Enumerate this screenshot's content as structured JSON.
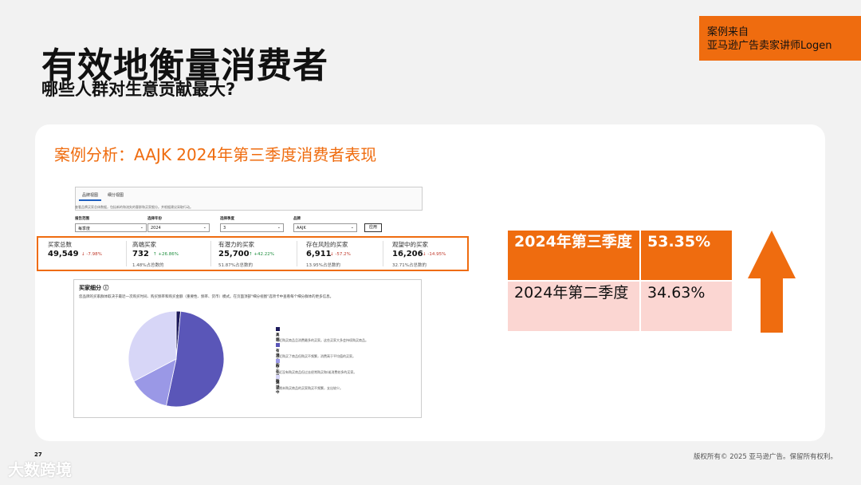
{
  "header": {
    "title": "有效地衡量消费者",
    "subtitle": "哪些人群对生意贡献最大?"
  },
  "source_badge": {
    "line1": "案例来自",
    "line2": "亚马逊广告卖家讲师Logen"
  },
  "card": {
    "title": "案例分析：AAJK 2024年第三季度消费者表现"
  },
  "screenshot": {
    "tabs": [
      {
        "label": "品牌视图",
        "active": true
      },
      {
        "label": "细分视图",
        "active": false
      }
    ],
    "description": "查看品牌买家总体数据，包括新的和流失的客群和买家细分。并根据建议采取行动。",
    "filters": [
      {
        "label": "报告范围",
        "value": "每季度"
      },
      {
        "label": "选择年份",
        "value": "2024"
      },
      {
        "label": "选择季度",
        "value": "3"
      },
      {
        "label": "品牌",
        "value": "AAJK"
      }
    ],
    "apply_label": "应用",
    "metrics": [
      {
        "label": "买家总数",
        "value": "49,549",
        "change": "↓ -7.98%",
        "trend": "down",
        "share": ""
      },
      {
        "label": "高端买家",
        "value": "732",
        "change": "↑ +26.86%",
        "trend": "up",
        "share": "1.48%占总数的"
      },
      {
        "label": "有潜力的买家",
        "value": "25,700",
        "change": "↑ +42.22%",
        "trend": "up",
        "share": "51.87%占总数的"
      },
      {
        "label": "存在风险的买家",
        "value": "6,911",
        "change": "↓ -57.2%",
        "trend": "down",
        "share": "13.95%占总数的"
      },
      {
        "label": "观望中的买家",
        "value": "16,206",
        "change": "↓ -14.95%",
        "trend": "down",
        "share": "32.71%占总数的"
      }
    ],
    "segments": {
      "title": "买家细分 ⓘ",
      "description": "您品牌的买家群体取决于最近一次购买时间、购买频率和购买金额（重要性、频率、货币）模式。在页面顶部\"细分视图\"选项卡中查看每个细分群体的更多信息。",
      "legend": [
        {
          "label": "高端",
          "desc": "最近购买商品且消费最多的买家。这些买家大多会持续购买商品。",
          "color": "#1d1a5c"
        },
        {
          "label": "有潜力的",
          "desc": "最近购买了商品但购买不频繁，消费高于平均值的买家。",
          "color": "#5a56b8"
        },
        {
          "label": "存在风险",
          "desc": "最近没有购买商品但过去经常购买和/或消费较多的买家。",
          "color": "#9a98e6"
        },
        {
          "label": "观望中",
          "desc": "长期未购买商品的买家购买不频繁，支出较少。",
          "color": "#d7d6f7"
        }
      ]
    }
  },
  "chart_data": {
    "type": "pie",
    "categories": [
      "高端",
      "有潜力的",
      "存在风险",
      "观望中"
    ],
    "values": [
      1.48,
      51.87,
      13.95,
      32.71
    ],
    "colors": [
      "#1d1a5c",
      "#5a56b8",
      "#9a98e6",
      "#d7d6f7"
    ]
  },
  "comparison": {
    "rows": [
      {
        "period": "2024年第三季度",
        "value": "53.35%",
        "highlight": true
      },
      {
        "period": "2024年第二季度",
        "value": "34.63%",
        "highlight": false
      }
    ],
    "arrow_color": "#ef6c0f"
  },
  "footer": {
    "page_number": "27",
    "copyright": "版权所有© 2025 亚马逊广告。保留所有权利。",
    "watermark": "大数跨境"
  }
}
